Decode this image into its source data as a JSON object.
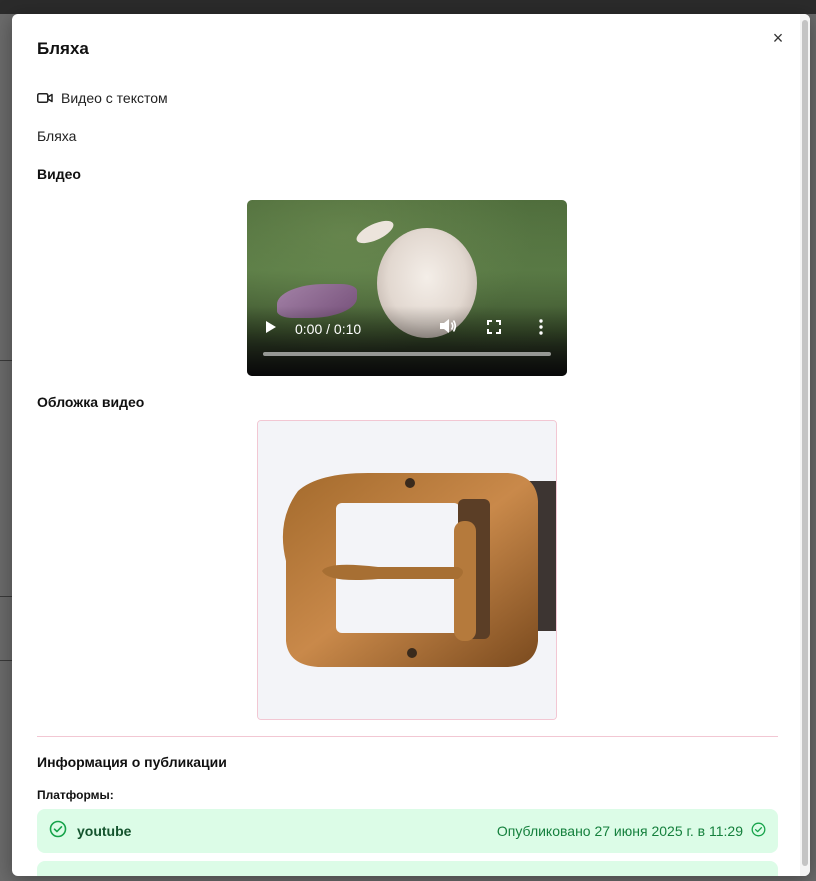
{
  "modal": {
    "title": "Бляха",
    "close_label": "×",
    "post_type": {
      "icon": "video-camera-icon",
      "label": "Видео с текстом"
    },
    "description": "Бляха",
    "video_section_label": "Видео",
    "video": {
      "time": "0:00 / 0:10",
      "progress": 0
    },
    "cover_section_label": "Обложка видео",
    "publication_info_label": "Информация о публикации",
    "platforms_label": "Платформы:",
    "platforms": [
      {
        "name": "youtube",
        "status": "Опубликовано 27 июня 2025 г. в 11:29"
      }
    ]
  },
  "colors": {
    "success_bg": "#dcfce7",
    "success_text": "#15803d",
    "divider": "#f2c7d3"
  }
}
